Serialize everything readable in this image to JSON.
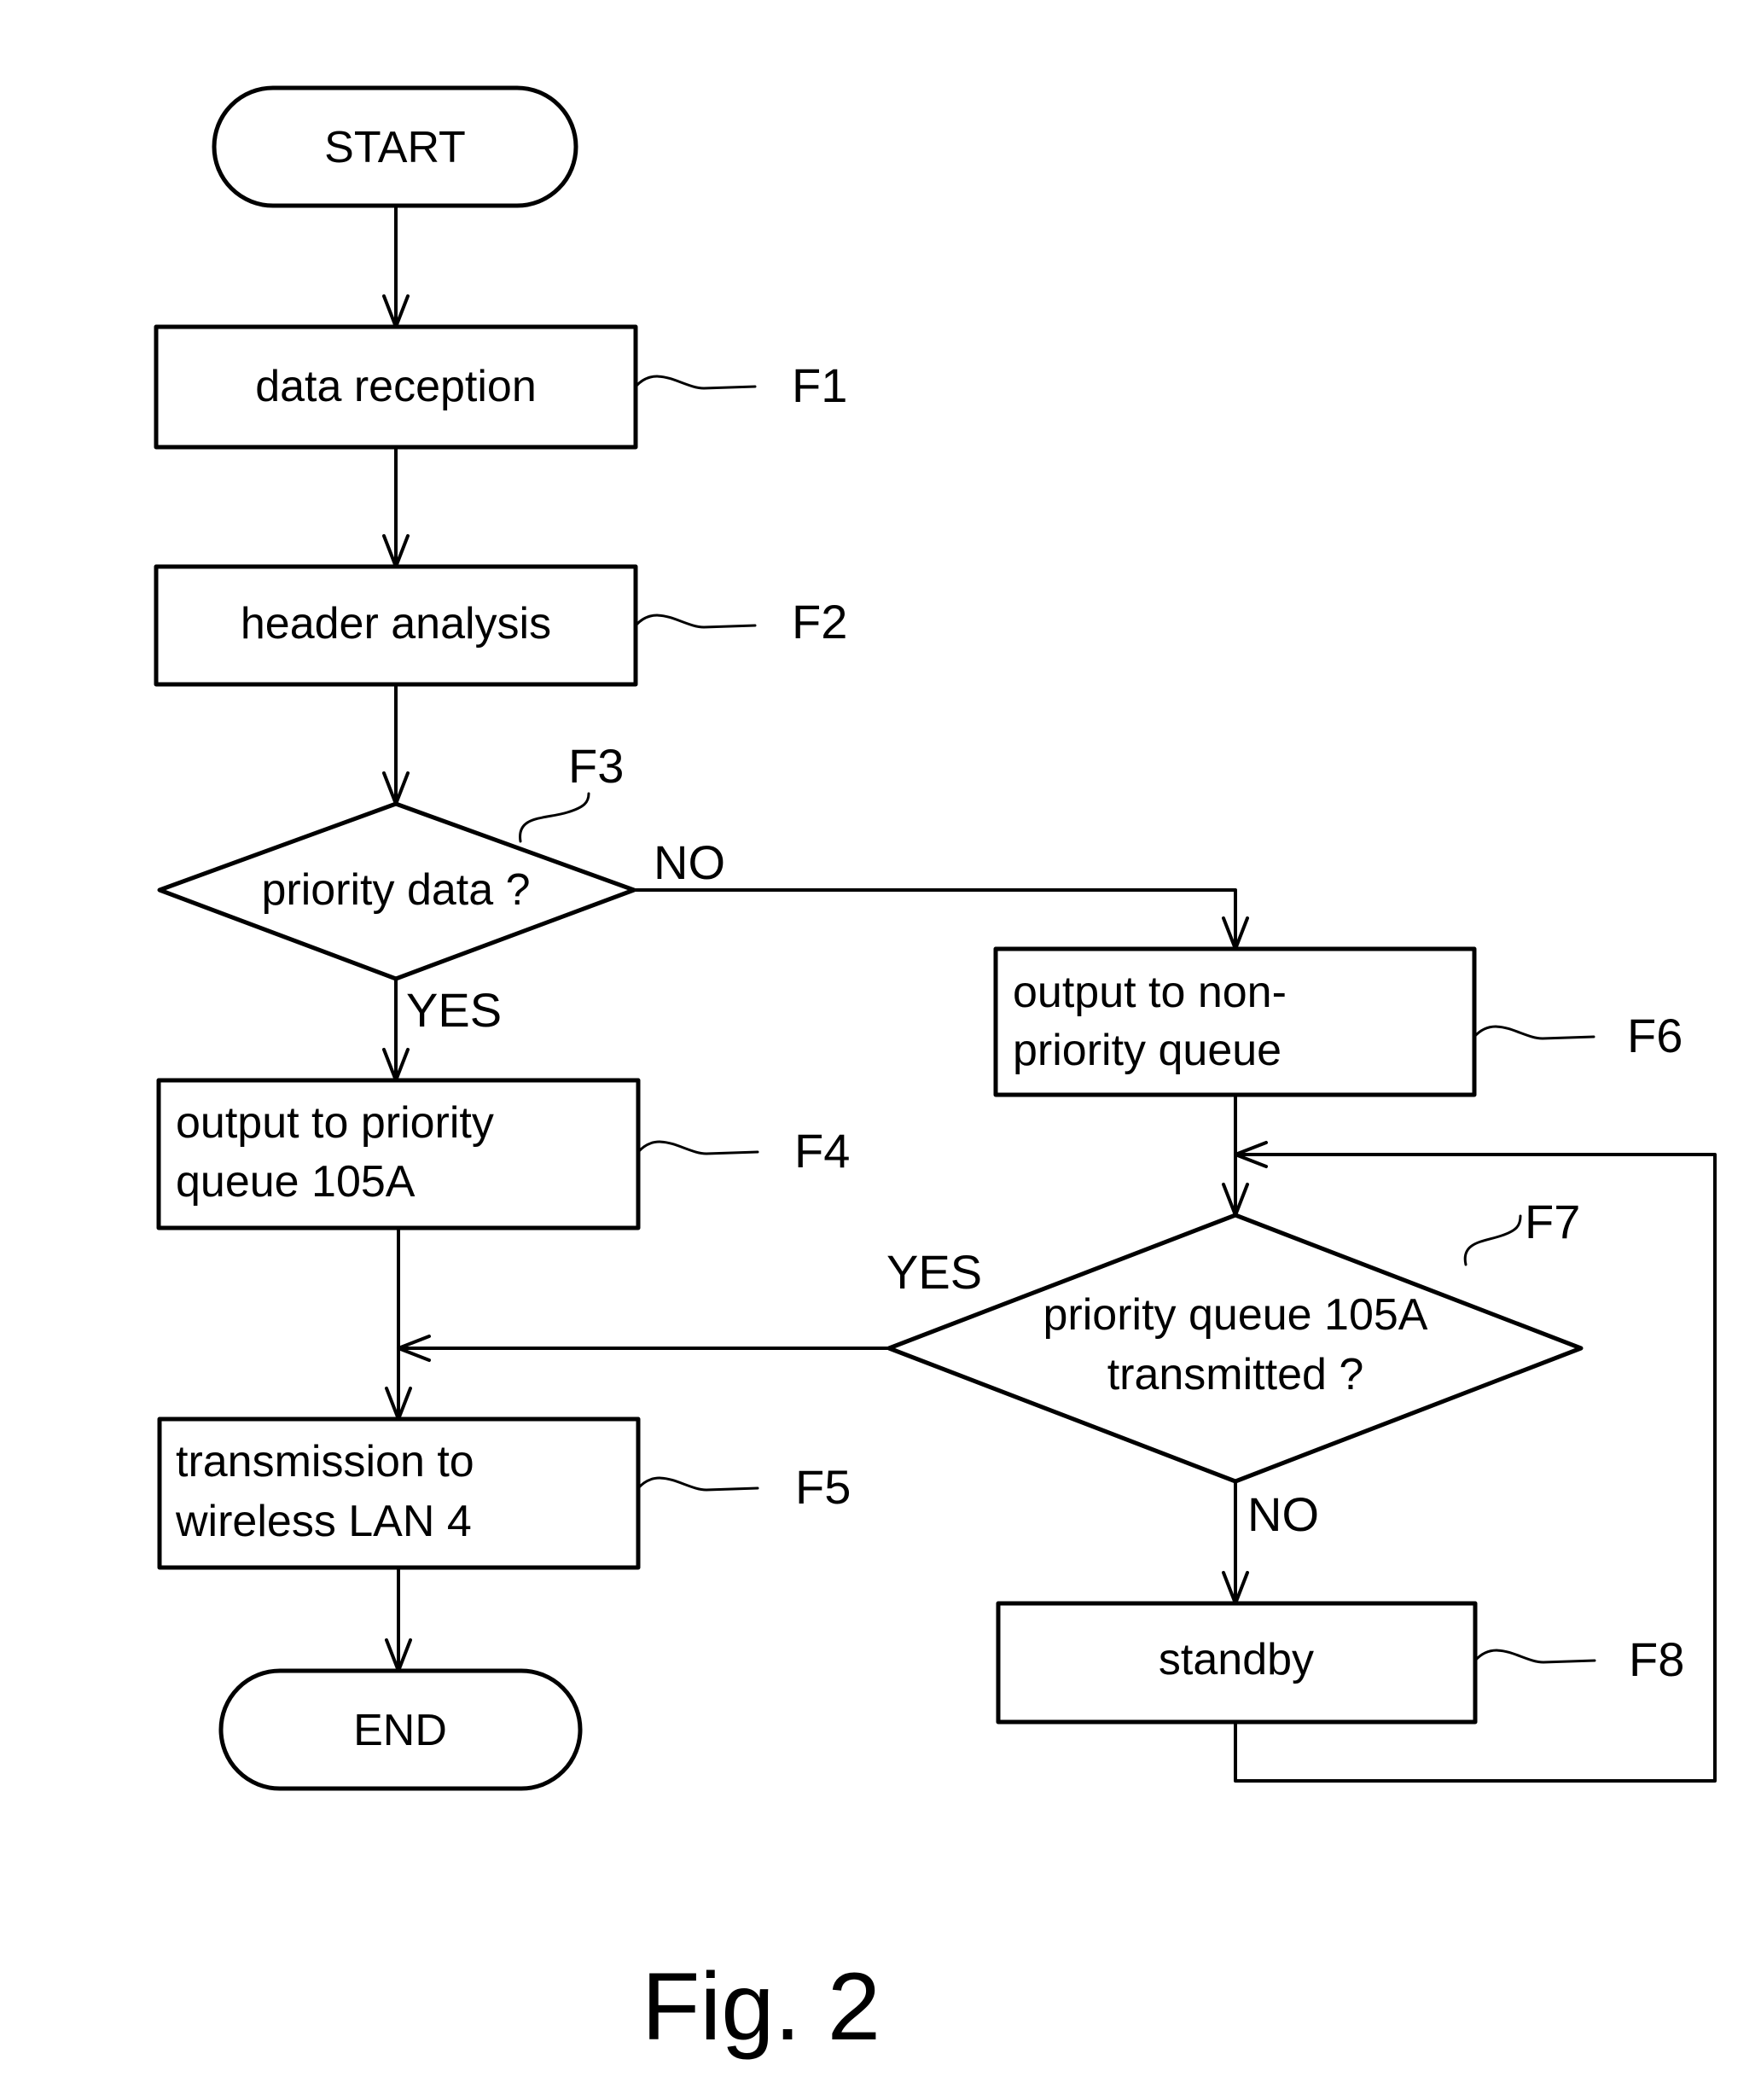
{
  "figure": {
    "caption": "Fig. 2"
  },
  "nodes": {
    "start": {
      "label": "START"
    },
    "f1": {
      "lines": [
        "data reception"
      ],
      "ref": "F1"
    },
    "f2": {
      "lines": [
        "header analysis"
      ],
      "ref": "F2"
    },
    "f3": {
      "lines": [
        "priority data ?"
      ],
      "ref": "F3",
      "yes_label": "YES",
      "no_label": "NO"
    },
    "f4": {
      "lines": [
        "output to priority",
        "queue 105A"
      ],
      "ref": "F4"
    },
    "f5": {
      "lines": [
        "transmission to",
        "wireless LAN 4"
      ],
      "ref": "F5"
    },
    "f6": {
      "lines": [
        "output to non-",
        "priority queue"
      ],
      "ref": "F6"
    },
    "f7": {
      "lines": [
        "priority queue 105A",
        "transmitted ?"
      ],
      "ref": "F7",
      "yes_label": "YES",
      "no_label": "NO"
    },
    "f8": {
      "lines": [
        "standby"
      ],
      "ref": "F8"
    },
    "end": {
      "label": "END"
    }
  }
}
